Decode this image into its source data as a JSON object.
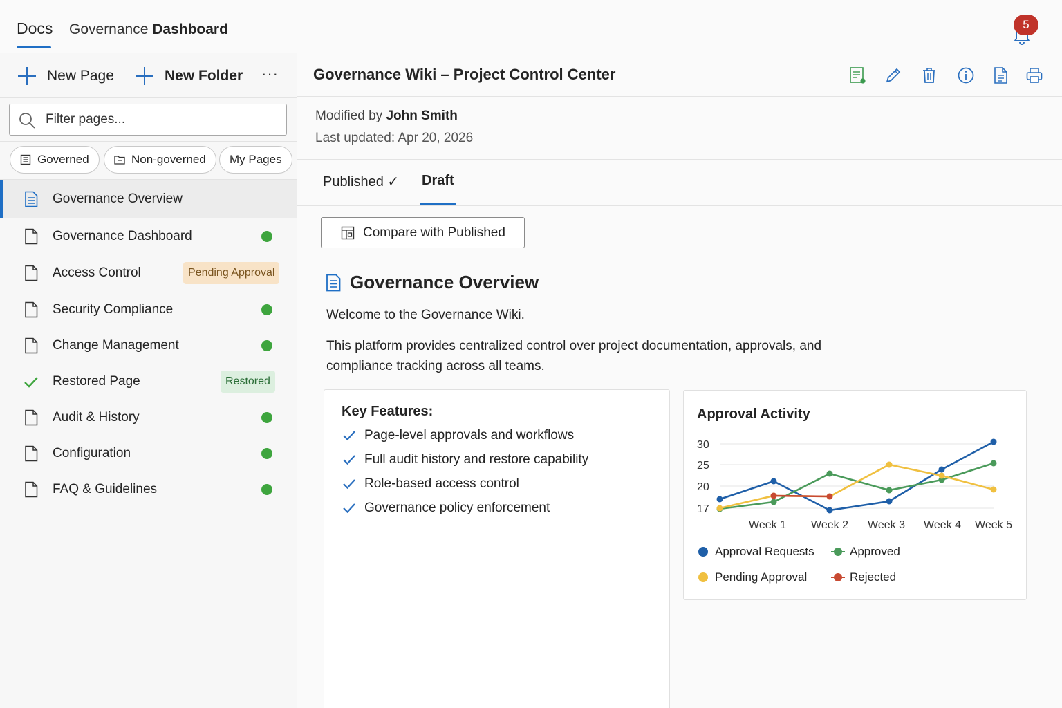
{
  "app": {
    "brand": "Docs",
    "breadcrumb_prefix": "Governance",
    "breadcrumb_current": "Dashboard",
    "notification_count": "5"
  },
  "sidebar": {
    "new_page": "New Page",
    "new_folder": "New Folder",
    "more": "···",
    "filter_placeholder": "Filter pages...",
    "chips": [
      {
        "label": "Governed"
      },
      {
        "label": "Non-governed"
      },
      {
        "label": "My Pages"
      }
    ],
    "items": [
      {
        "label": "Governance Overview",
        "active": true
      },
      {
        "label": "Governance Dashboard",
        "status": "green"
      },
      {
        "label": "Access Control",
        "badge": "Pending Approval"
      },
      {
        "label": "Security Compliance",
        "status": "green"
      },
      {
        "label": "Change Management",
        "status": "green"
      },
      {
        "label": "Restored Page",
        "badge": "Restored"
      },
      {
        "label": "Audit & History",
        "status": "green"
      },
      {
        "label": "Configuration",
        "status": "green"
      },
      {
        "label": "FAQ & Guidelines",
        "status": "green"
      }
    ]
  },
  "page": {
    "title": "Governance Wiki – Project Control Center",
    "modified_by_label": "Modified by",
    "modified_by": "John Smith",
    "last_updated": "Last updated: Apr 20, 2026",
    "tabs": [
      {
        "label": "Published ✓"
      },
      {
        "label": "Draft",
        "active": true
      }
    ],
    "compare_label": "Compare with Published",
    "content_title": "Governance Overview",
    "intro": "Welcome to the Governance Wiki.",
    "description": "This platform provides centralized control over project documentation, approvals, and compliance tracking across all teams.",
    "features_title": "Key Features:",
    "features": [
      "Page-level approvals and workflows",
      "Full audit history and restore capability",
      "Role-based access control",
      "Governance policy enforcement"
    ]
  },
  "colors": {
    "accent": "#1f6fc5",
    "green": "#3ea53e",
    "blue_series": "#1f5fa8",
    "green_series": "#4a9a5a",
    "yellow_series": "#f0c040",
    "red_series": "#c84a32"
  },
  "chart_data": {
    "type": "line",
    "title": "Approval Activity",
    "categories": [
      "Week 1",
      "Week 2",
      "Week 3",
      "Week 4",
      "Week 5"
    ],
    "x": [
      0,
      0.9,
      2.0,
      3.0,
      3.9,
      4.9
    ],
    "x_note_ticks_at": [
      0.9,
      2.0,
      3.0,
      3.9,
      4.9
    ],
    "yticks": [
      17,
      25,
      20,
      30
    ],
    "ylim": [
      17,
      30
    ],
    "grid": true,
    "legend_placement": "bottom",
    "series": [
      {
        "name": "Approval Requests",
        "color": "#1f5fa8",
        "values": [
          19.2,
          24.0,
          17.1,
          19.6,
          26.1,
          30.5
        ]
      },
      {
        "name": "Approved",
        "color": "#4a9a5a",
        "values": [
          17.6,
          19.6,
          25.5,
          21.4,
          23.5,
          26.8
        ]
      },
      {
        "name": "Pending Approval",
        "color": "#f0c040",
        "values": [
          17.8,
          20.4,
          20.2,
          27.4,
          24.3,
          22.6
        ]
      },
      {
        "name": "Rejected",
        "color": "#c84a32",
        "values": [
          null,
          20.4,
          19.8,
          null,
          null,
          null
        ]
      }
    ]
  }
}
